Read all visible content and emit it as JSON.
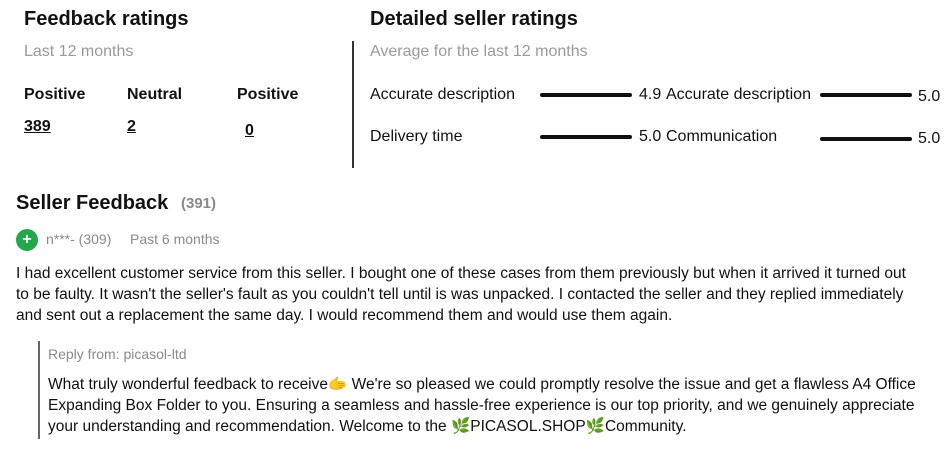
{
  "feedback": {
    "title": "Feedback ratings",
    "period": "Last 12 months",
    "columns": [
      {
        "label": "Positive",
        "value": "389"
      },
      {
        "label": "Neutral",
        "value": "2"
      },
      {
        "label": "Positive",
        "value": "0"
      }
    ]
  },
  "detailed": {
    "title": "Detailed seller ratings",
    "subtitle": "Average for the last 12 months",
    "rows": [
      {
        "left_label": "Accurate description",
        "left_value": "4.9",
        "right_label": "Accurate description",
        "right_value": "5.0"
      },
      {
        "left_label": "Delivery time",
        "left_value": "5.0",
        "right_label": "Communication",
        "right_value": "5.0"
      }
    ]
  },
  "seller_feedback": {
    "title": "Seller Feedback",
    "count": "(391)",
    "item": {
      "badge": "+",
      "user": "n***- (309)",
      "when": "Past 6 months",
      "comment_lines": [
        "I had excellent customer service from this seller. I bought one of these cases from them previously but when it arrived it turned out",
        "to be faulty. It wasn't the seller's fault as you couldn't tell until is was unpacked. I contacted the seller and they replied immediately",
        "and sent out a replacement the same day. I would recommend them and would use them again."
      ],
      "reply_from": "Reply from: picasol-ltd",
      "reply_lines": [
        "What truly wonderful feedback to receive🫱 We're so pleased we could promptly resolve the issue and get a flawless A4 Office",
        "Expanding Box Folder to you. Ensuring a seamless and hassle-free experience is our top priority, and we genuinely appreciate",
        "your understanding and recommendation. Welcome to the 🌿PICASOL.SHOP🌿Community."
      ]
    }
  }
}
